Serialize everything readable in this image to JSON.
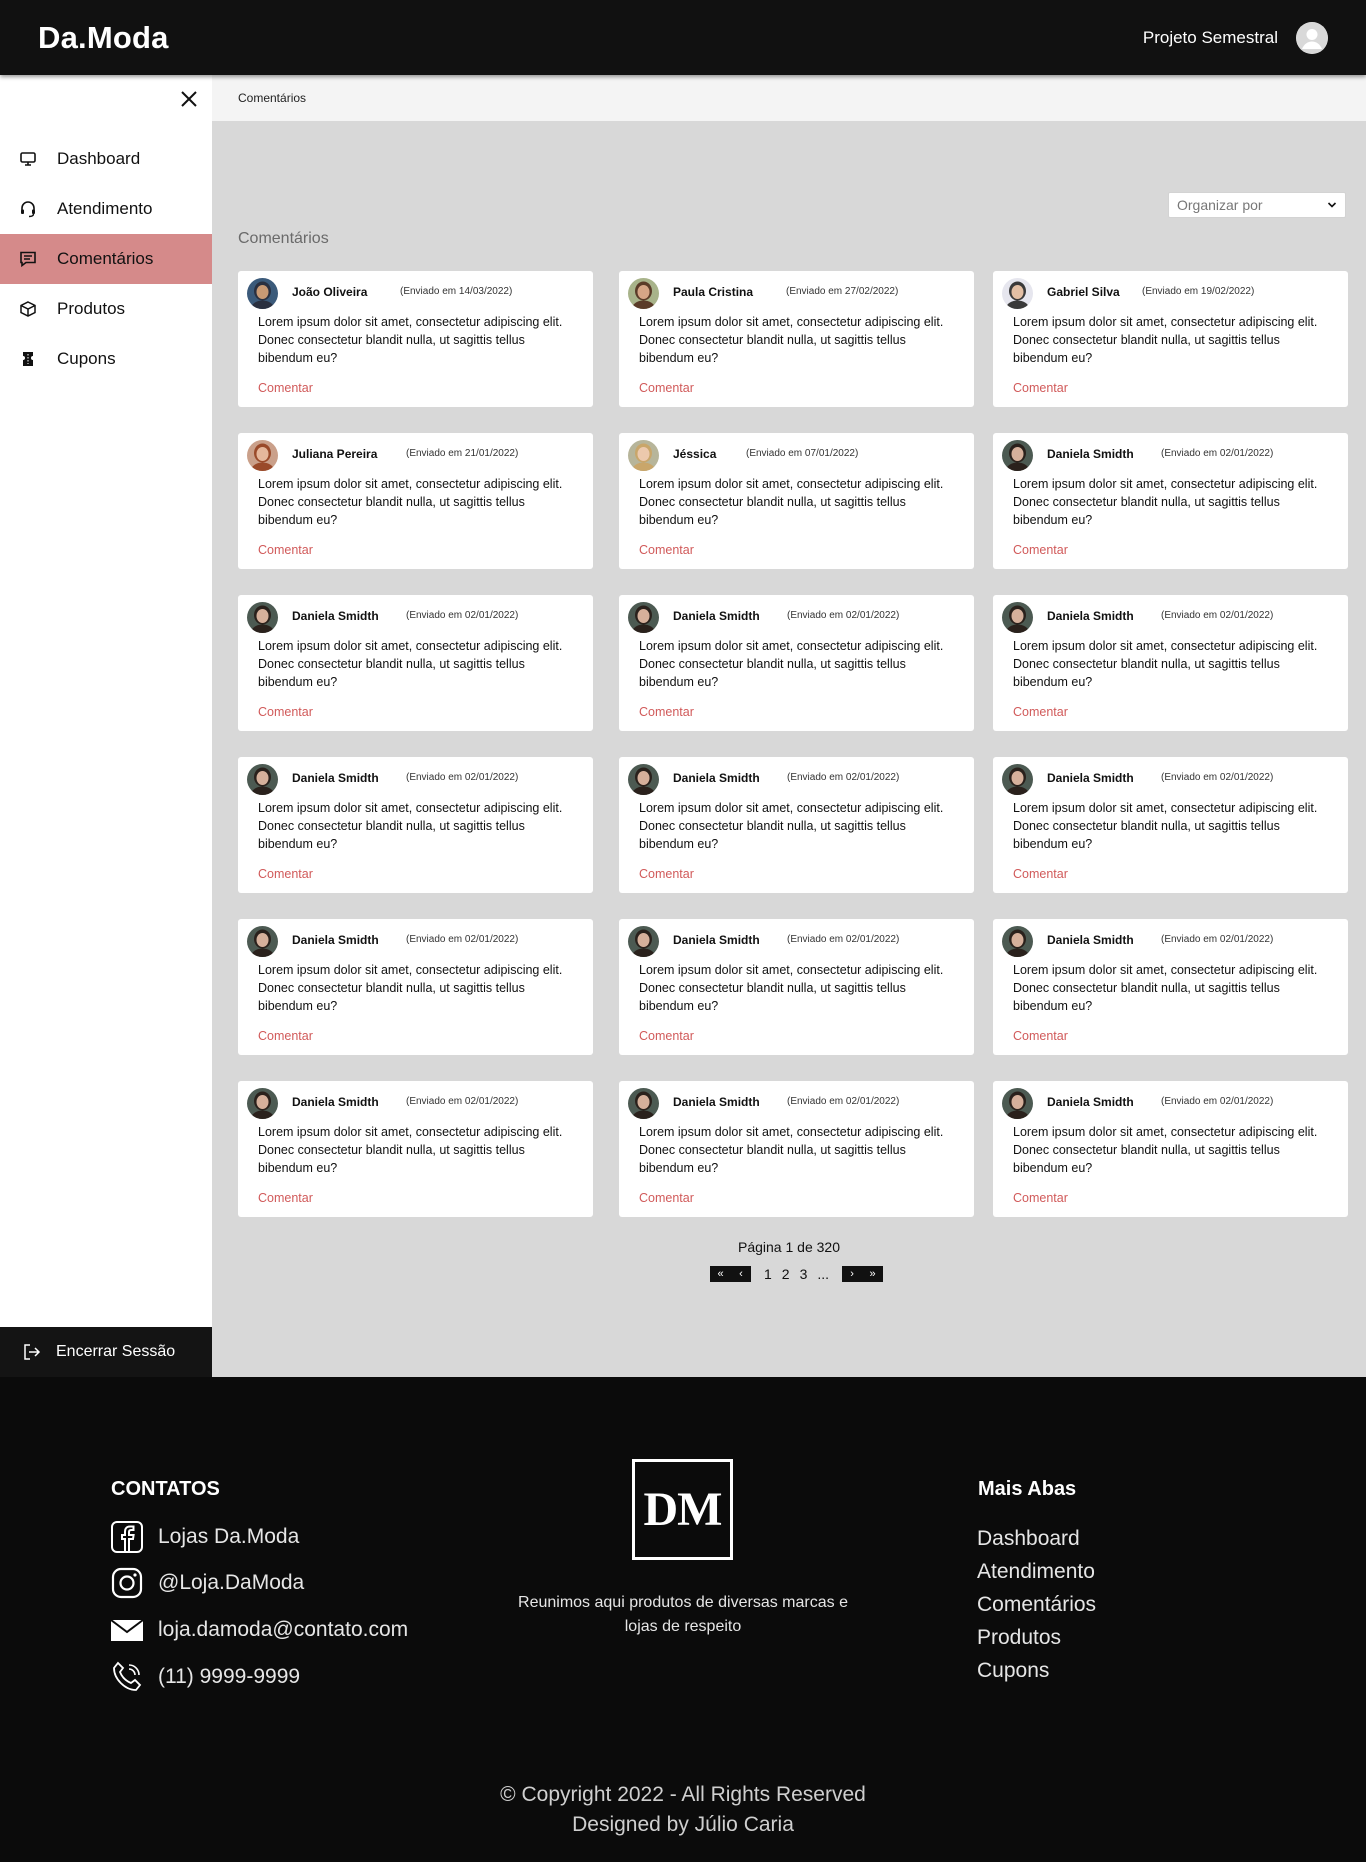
{
  "header": {
    "logo": "Da.Moda",
    "project_name": "Projeto Semestral",
    "avatar_icon": "user-avatar-icon"
  },
  "sidebar": {
    "items": [
      {
        "label": "Dashboard",
        "icon": "monitor-icon",
        "active": false
      },
      {
        "label": "Atendimento",
        "icon": "headset-icon",
        "active": false
      },
      {
        "label": "Comentários",
        "icon": "comment-icon",
        "active": true
      },
      {
        "label": "Produtos",
        "icon": "box-icon",
        "active": false
      },
      {
        "label": "Cupons",
        "icon": "coupon-icon",
        "active": false
      }
    ],
    "logout": "Encerrar Sessão"
  },
  "breadcrumb": "Comentários",
  "main": {
    "sort_placeholder": "Organizar por",
    "section_title": "Comentários",
    "comments": [
      {
        "name": "João Oliveira",
        "date": "(Enviado em 14/03/2022)",
        "text": "Lorem ipsum dolor sit amet, consectetur adipiscing elit. Donec consectetur blandit nulla, ut sagittis tellus bibendum eu?",
        "action": "Comentar",
        "avatar": "avatar-man-cap"
      },
      {
        "name": "Paula Cristina",
        "date": "(Enviado em 27/02/2022)",
        "text": "Lorem ipsum dolor sit amet, consectetur adipiscing elit. Donec consectetur blandit nulla, ut sagittis tellus bibendum eu?",
        "action": "Comentar",
        "avatar": "avatar-woman-curly"
      },
      {
        "name": "Gabriel Silva",
        "date": "(Enviado em 19/02/2022)",
        "text": "Lorem ipsum dolor sit amet, consectetur adipiscing elit. Donec consectetur blandit nulla, ut sagittis tellus bibendum eu?",
        "action": "Comentar",
        "avatar": "avatar-man-suit"
      },
      {
        "name": "Juliana Pereira",
        "date": "(Enviado em 21/01/2022)",
        "text": "Lorem ipsum dolor sit amet, consectetur adipiscing elit. Donec consectetur blandit nulla, ut sagittis tellus bibendum eu?",
        "action": "Comentar",
        "avatar": "avatar-woman-red"
      },
      {
        "name": "Jéssica",
        "date": "(Enviado em 07/01/2022)",
        "text": "Lorem ipsum dolor sit amet, consectetur adipiscing elit. Donec consectetur blandit nulla, ut sagittis tellus bibendum eu?",
        "action": "Comentar",
        "avatar": "avatar-woman-blonde"
      },
      {
        "name": "Daniela Smidth",
        "date": "(Enviado em 02/01/2022)",
        "text": "Lorem ipsum dolor sit amet, consectetur adipiscing elit. Donec consectetur blandit nulla, ut sagittis tellus bibendum eu?",
        "action": "Comentar",
        "avatar": "avatar-woman-dark"
      },
      {
        "name": "Daniela Smidth",
        "date": "(Enviado em 02/01/2022)",
        "text": "Lorem ipsum dolor sit amet, consectetur adipiscing elit. Donec consectetur blandit nulla, ut sagittis tellus bibendum eu?",
        "action": "Comentar",
        "avatar": "avatar-woman-dark"
      },
      {
        "name": "Daniela Smidth",
        "date": "(Enviado em 02/01/2022)",
        "text": "Lorem ipsum dolor sit amet, consectetur adipiscing elit. Donec consectetur blandit nulla, ut sagittis tellus bibendum eu?",
        "action": "Comentar",
        "avatar": "avatar-woman-dark"
      },
      {
        "name": "Daniela Smidth",
        "date": "(Enviado em 02/01/2022)",
        "text": "Lorem ipsum dolor sit amet, consectetur adipiscing elit. Donec consectetur blandit nulla, ut sagittis tellus bibendum eu?",
        "action": "Comentar",
        "avatar": "avatar-woman-dark"
      },
      {
        "name": "Daniela Smidth",
        "date": "(Enviado em 02/01/2022)",
        "text": "Lorem ipsum dolor sit amet, consectetur adipiscing elit. Donec consectetur blandit nulla, ut sagittis tellus bibendum eu?",
        "action": "Comentar",
        "avatar": "avatar-woman-dark"
      },
      {
        "name": "Daniela Smidth",
        "date": "(Enviado em 02/01/2022)",
        "text": "Lorem ipsum dolor sit amet, consectetur adipiscing elit. Donec consectetur blandit nulla, ut sagittis tellus bibendum eu?",
        "action": "Comentar",
        "avatar": "avatar-woman-dark"
      },
      {
        "name": "Daniela Smidth",
        "date": "(Enviado em 02/01/2022)",
        "text": "Lorem ipsum dolor sit amet, consectetur adipiscing elit. Donec consectetur blandit nulla, ut sagittis tellus bibendum eu?",
        "action": "Comentar",
        "avatar": "avatar-woman-dark"
      },
      {
        "name": "Daniela Smidth",
        "date": "(Enviado em 02/01/2022)",
        "text": "Lorem ipsum dolor sit amet, consectetur adipiscing elit. Donec consectetur blandit nulla, ut sagittis tellus bibendum eu?",
        "action": "Comentar",
        "avatar": "avatar-woman-dark"
      },
      {
        "name": "Daniela Smidth",
        "date": "(Enviado em 02/01/2022)",
        "text": "Lorem ipsum dolor sit amet, consectetur adipiscing elit. Donec consectetur blandit nulla, ut sagittis tellus bibendum eu?",
        "action": "Comentar",
        "avatar": "avatar-woman-dark"
      },
      {
        "name": "Daniela Smidth",
        "date": "(Enviado em 02/01/2022)",
        "text": "Lorem ipsum dolor sit amet, consectetur adipiscing elit. Donec consectetur blandit nulla, ut sagittis tellus bibendum eu?",
        "action": "Comentar",
        "avatar": "avatar-woman-dark"
      },
      {
        "name": "Daniela Smidth",
        "date": "(Enviado em 02/01/2022)",
        "text": "Lorem ipsum dolor sit amet, consectetur adipiscing elit. Donec consectetur blandit nulla, ut sagittis tellus bibendum eu?",
        "action": "Comentar",
        "avatar": "avatar-woman-dark"
      },
      {
        "name": "Daniela Smidth",
        "date": "(Enviado em 02/01/2022)",
        "text": "Lorem ipsum dolor sit amet, consectetur adipiscing elit. Donec consectetur blandit nulla, ut sagittis tellus bibendum eu?",
        "action": "Comentar",
        "avatar": "avatar-woman-dark"
      },
      {
        "name": "Daniela Smidth",
        "date": "(Enviado em 02/01/2022)",
        "text": "Lorem ipsum dolor sit amet, consectetur adipiscing elit. Donec consectetur blandit nulla, ut sagittis tellus bibendum eu?",
        "action": "Comentar",
        "avatar": "avatar-woman-dark"
      }
    ],
    "pagination": {
      "label": "Página 1 de 320",
      "first": "«",
      "prev": "‹",
      "pages": [
        "1",
        "2",
        "3",
        "..."
      ],
      "next": "›",
      "last": "»"
    }
  },
  "footer": {
    "contacts_heading": "CONTATOS",
    "contacts": [
      {
        "label": "Lojas Da.Moda",
        "icon": "facebook-icon"
      },
      {
        "label": "@Loja.DaModa",
        "icon": "instagram-icon"
      },
      {
        "label": "loja.damoda@contato.com",
        "icon": "mail-icon"
      },
      {
        "label": "(11) 9999-9999",
        "icon": "phone-icon"
      }
    ],
    "brand_logo": "DM",
    "tagline": "Reunimos aqui produtos de diversas marcas e lojas de respeito",
    "links_heading": "Mais Abas",
    "links": [
      "Dashboard",
      "Atendimento",
      "Comentários",
      "Produtos",
      "Cupons"
    ],
    "copyright": "© Copyright 2022 - All Rights Reserved",
    "designer": "Designed by Júlio Caria"
  },
  "colors": {
    "accent": "#d58a8a",
    "link": "#d15a5a",
    "header_bg": "#111111",
    "main_bg": "#d8d8d8"
  }
}
